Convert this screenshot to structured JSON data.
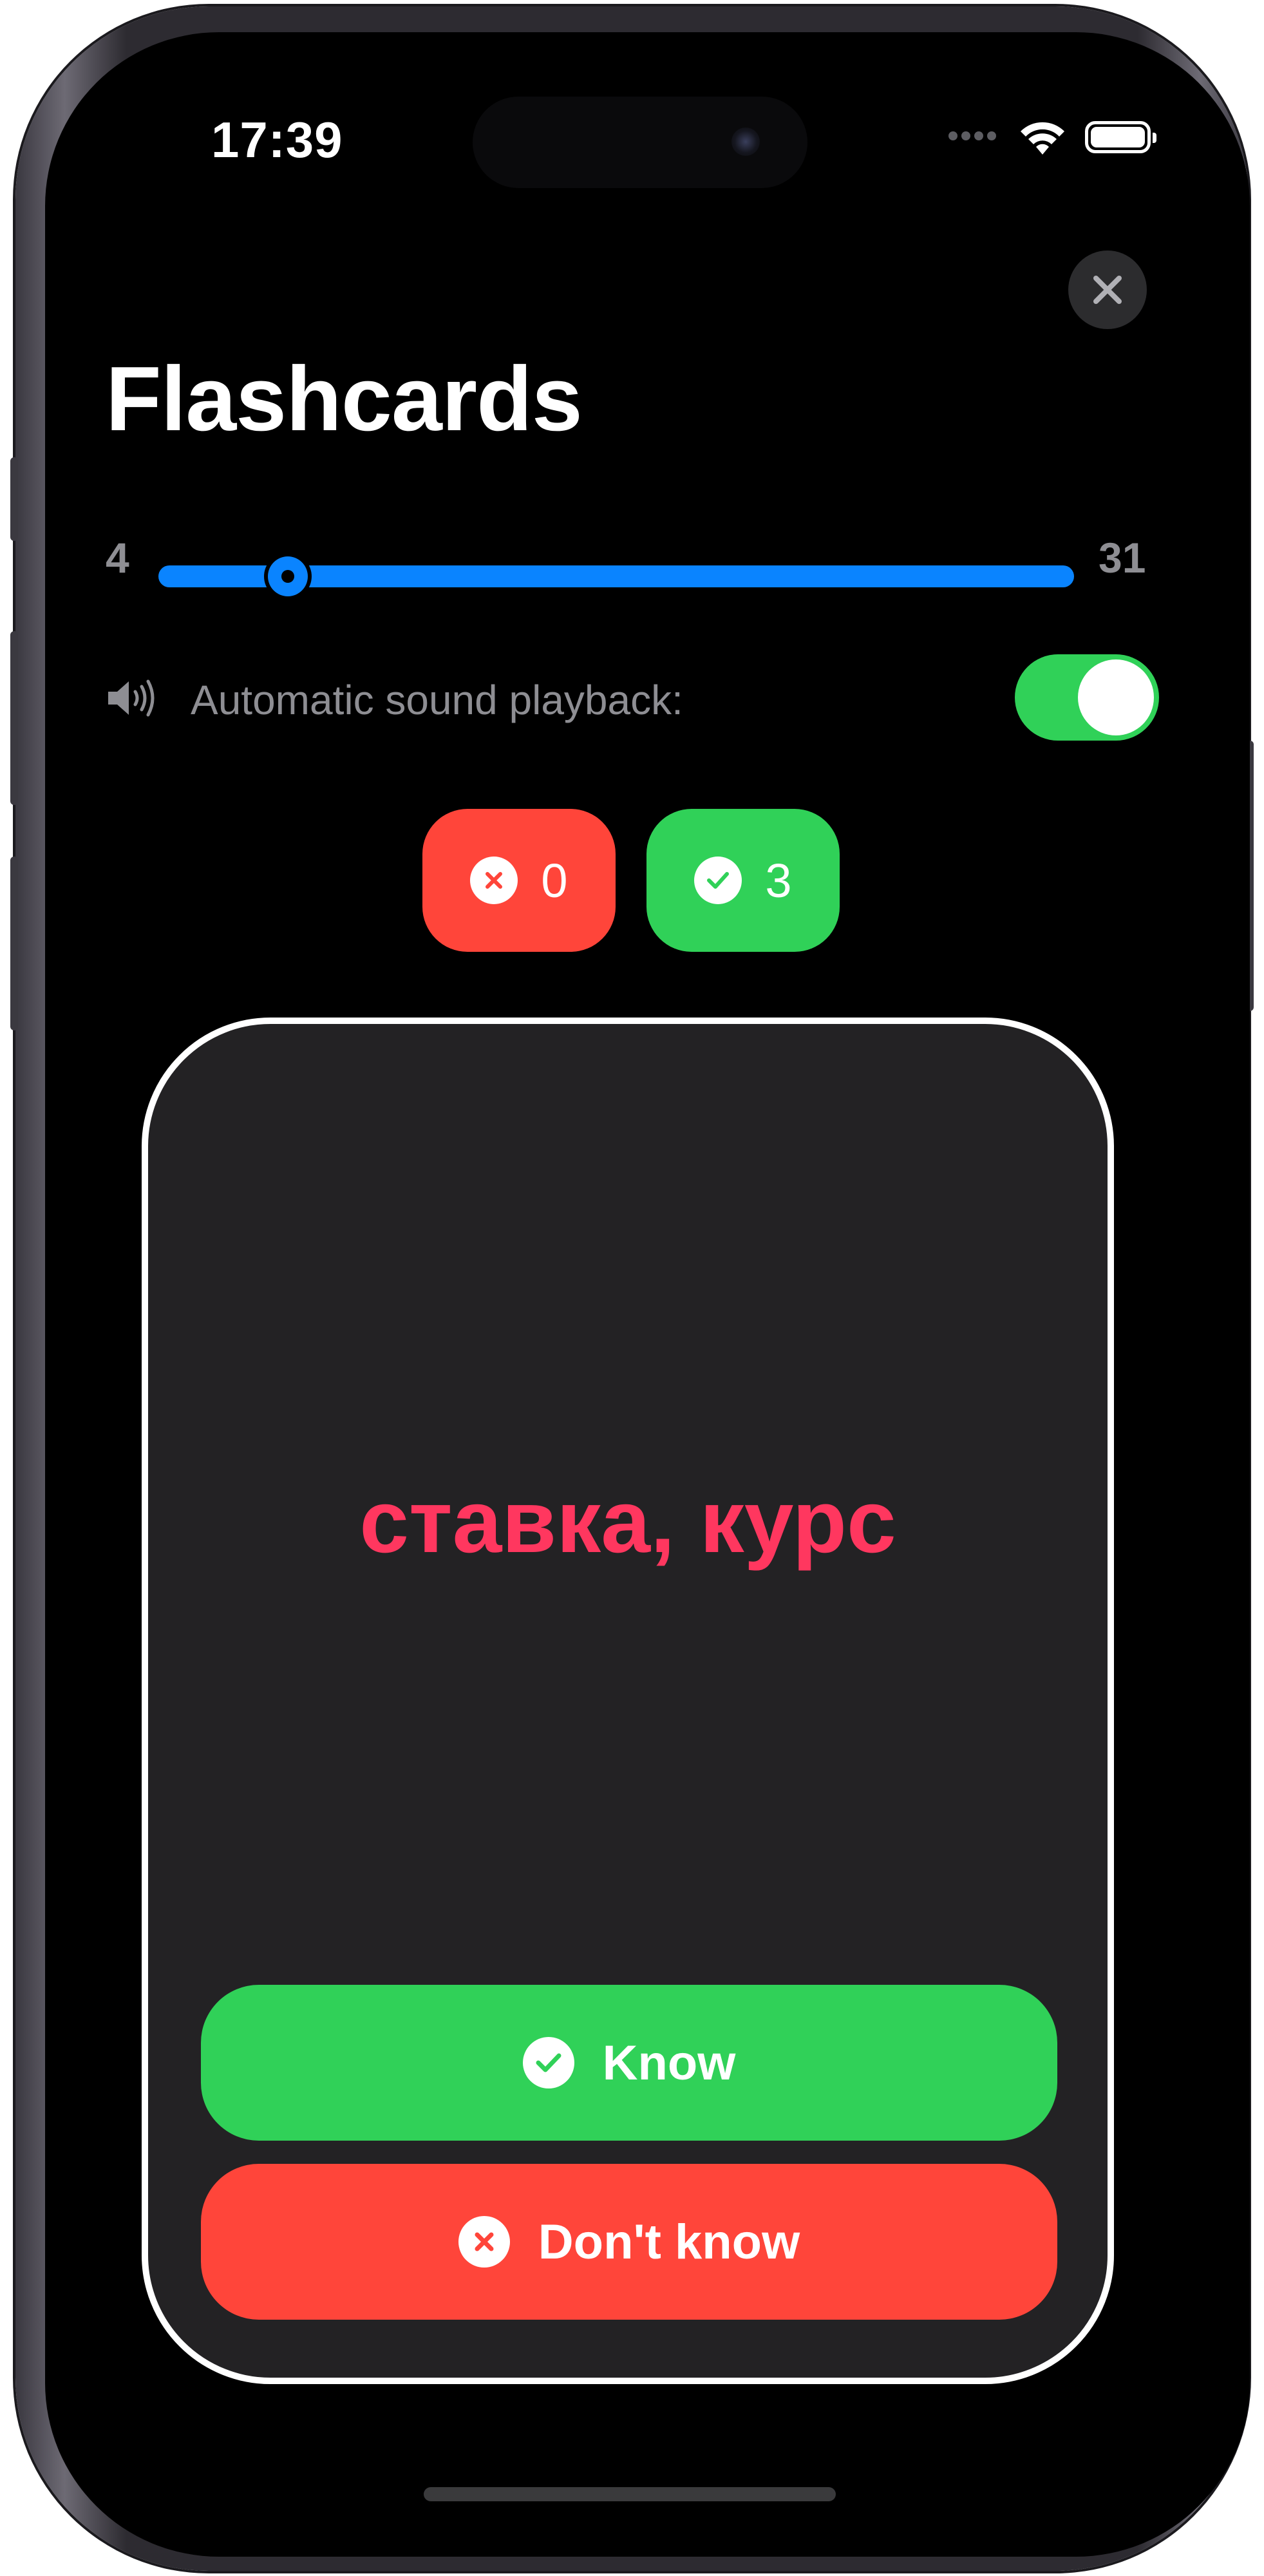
{
  "status_bar": {
    "time": "17:39",
    "signal_icon": "signal-dots-icon",
    "wifi_icon": "wifi-icon",
    "battery_icon": "battery-icon"
  },
  "header": {
    "title": "Flashcards",
    "close_icon": "close-icon"
  },
  "range": {
    "min_label": "4",
    "max_label": "31",
    "selected_start": 4,
    "selected_end": 31
  },
  "auto_sound": {
    "icon": "speaker-icon",
    "label": "Automatic sound playback:",
    "enabled": true
  },
  "counters": {
    "wrong": {
      "icon": "x-circle-icon",
      "count": "0"
    },
    "right": {
      "icon": "check-circle-icon",
      "count": "3"
    }
  },
  "card": {
    "word": "ставка, курс",
    "know_label": "Know",
    "dont_know_label": "Don't know"
  },
  "colors": {
    "accent_blue": "#0a84ff",
    "green": "#30d158",
    "red": "#ff453a",
    "word_pink": "#ff375f",
    "card_bg": "#232224"
  }
}
